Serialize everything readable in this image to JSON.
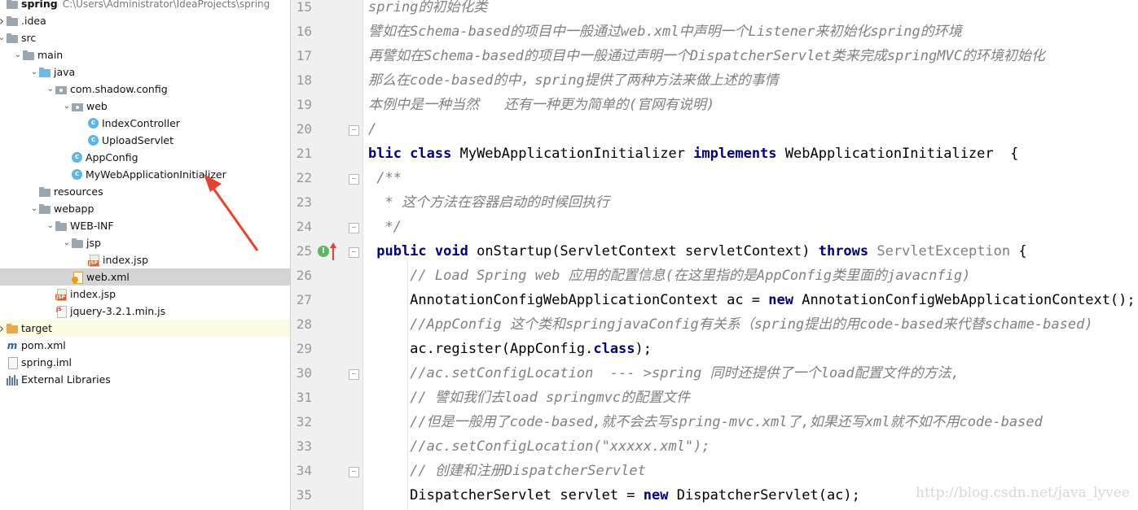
{
  "tree": {
    "items": [
      {
        "label": "spring",
        "path": "C:\\Users\\Administrator\\IdeaProjects\\spring",
        "icon": "folder-icon",
        "arrow": "",
        "indent": 0
      },
      {
        "label": ".idea",
        "icon": "folder-icon",
        "arrow": "collapsed",
        "indent": 0
      },
      {
        "label": "src",
        "icon": "folder-icon",
        "arrow": "expanded",
        "indent": 0
      },
      {
        "label": "main",
        "icon": "folder-icon",
        "arrow": "expanded",
        "indent": 1
      },
      {
        "label": "java",
        "icon": "source-folder-icon",
        "arrow": "expanded",
        "indent": 2
      },
      {
        "label": "com.shadow.config",
        "icon": "package-icon",
        "arrow": "expanded",
        "indent": 3
      },
      {
        "label": "web",
        "icon": "package-icon",
        "arrow": "expanded",
        "indent": 4
      },
      {
        "label": "IndexController",
        "icon": "class-icon",
        "arrow": "",
        "indent": 5
      },
      {
        "label": "UploadServlet",
        "icon": "class-icon",
        "arrow": "",
        "indent": 5
      },
      {
        "label": "AppConfig",
        "icon": "class-icon",
        "arrow": "",
        "indent": 4
      },
      {
        "label": "MyWebApplicationInitializer",
        "icon": "class-icon",
        "arrow": "",
        "indent": 4
      },
      {
        "label": "resources",
        "icon": "resources-folder-icon",
        "arrow": "",
        "indent": 2
      },
      {
        "label": "webapp",
        "icon": "folder-icon",
        "arrow": "expanded",
        "indent": 2
      },
      {
        "label": "WEB-INF",
        "icon": "folder-icon",
        "arrow": "expanded",
        "indent": 3
      },
      {
        "label": "jsp",
        "icon": "folder-icon",
        "arrow": "expanded",
        "indent": 4
      },
      {
        "label": "index.jsp",
        "icon": "jsp-file-icon",
        "arrow": "",
        "indent": 5
      },
      {
        "label": "web.xml",
        "icon": "xml-file-icon",
        "arrow": "",
        "indent": 4
      },
      {
        "label": "index.jsp",
        "icon": "jsp-file-icon",
        "arrow": "",
        "indent": 3
      },
      {
        "label": "jquery-3.2.1.min.js",
        "icon": "js-file-icon",
        "arrow": "",
        "indent": 3
      },
      {
        "label": "target",
        "icon": "excluded-folder-icon",
        "arrow": "collapsed",
        "indent": 0
      },
      {
        "label": "pom.xml",
        "icon": "maven-icon",
        "arrow": "",
        "indent": 0
      },
      {
        "label": "spring.iml",
        "icon": "iml-file-icon",
        "arrow": "",
        "indent": 0
      },
      {
        "label": "External Libraries",
        "icon": "libraries-icon",
        "arrow": "",
        "indent": -1
      }
    ],
    "selected": "web.xml",
    "highlighted": "target"
  },
  "editor": {
    "lines": [
      {
        "n": "15",
        "segments": [
          [
            "cm",
            "spring的初始化类"
          ]
        ]
      },
      {
        "n": "16",
        "segments": [
          [
            "cm",
            "譬如在Schema-based的项目中一般通过web.xml中声明一个Listener来初始化spring的环境"
          ]
        ]
      },
      {
        "n": "17",
        "segments": [
          [
            "cm",
            "再譬如在Schema-based的项目中一般通过声明一个DispatcherServlet类来完成springMVC的环境初始化"
          ]
        ]
      },
      {
        "n": "18",
        "segments": [
          [
            "cm",
            "那么在code-based的中，spring提供了两种方法来做上述的事情"
          ]
        ]
      },
      {
        "n": "19",
        "segments": [
          [
            "cm",
            "本例中是一种当然   还有一种更为简单的(官网有说明)"
          ]
        ]
      },
      {
        "n": "20",
        "segments": [
          [
            "cm",
            "/"
          ]
        ]
      },
      {
        "n": "21",
        "segments": [
          [
            "kw",
            "blic class "
          ],
          [
            "pl",
            "MyWebApplicationInitializer "
          ],
          [
            "kw",
            "implements "
          ],
          [
            "pl",
            "WebApplicationInitializer  {"
          ]
        ]
      },
      {
        "n": "22",
        "segments": [
          [
            "cm",
            " /**"
          ]
        ]
      },
      {
        "n": "23",
        "segments": [
          [
            "cm",
            "  * 这个方法在容器启动的时候回执行"
          ]
        ]
      },
      {
        "n": "24",
        "segments": [
          [
            "cm",
            "  */"
          ]
        ]
      },
      {
        "n": "25",
        "segments": [
          [
            "pl",
            " "
          ],
          [
            "kw",
            "public void "
          ],
          [
            "pl",
            "onStartup(ServletContext servletContext) "
          ],
          [
            "kw",
            "throws "
          ],
          [
            "dim",
            "ServletException "
          ],
          [
            "pl",
            "{"
          ]
        ]
      },
      {
        "n": "26",
        "segments": [
          [
            "cm",
            "     // Load Spring web 应用的配置信息(在这里指的是AppConfig类里面的javacnfig)"
          ]
        ]
      },
      {
        "n": "27",
        "segments": [
          [
            "pl",
            "     AnnotationConfigWebApplicationContext ac = "
          ],
          [
            "kw",
            "new "
          ],
          [
            "pl",
            "AnnotationConfigWebApplicationContext();"
          ]
        ]
      },
      {
        "n": "28",
        "segments": [
          [
            "cm",
            "     //AppConfig 这个类和springjavaConfig有关系（spring提出的用code-based来代替schame-based)"
          ]
        ]
      },
      {
        "n": "29",
        "segments": [
          [
            "pl",
            "     ac.register(AppConfig."
          ],
          [
            "kw",
            "class"
          ],
          [
            "pl",
            ");"
          ]
        ]
      },
      {
        "n": "30",
        "segments": [
          [
            "cm",
            "     //ac.setConfigLocation  --- >spring 同时还提供了一个load配置文件的方法,"
          ]
        ]
      },
      {
        "n": "31",
        "segments": [
          [
            "cm",
            "     // 譬如我们去load springmvc的配置文件"
          ]
        ]
      },
      {
        "n": "32",
        "segments": [
          [
            "cm",
            "     //但是一般用了code-based,就不会去写spring-mvc.xml了,如果还写xml就不如不用code-based"
          ]
        ]
      },
      {
        "n": "33",
        "segments": [
          [
            "cm",
            "     //ac.setConfigLocation(\"xxxxx.xml\");"
          ]
        ]
      },
      {
        "n": "34",
        "segments": [
          [
            "cm",
            "     // 创建和注册DispatcherServlet"
          ]
        ]
      },
      {
        "n": "35",
        "segments": [
          [
            "pl",
            "     DispatcherServlet servlet = "
          ],
          [
            "kw",
            "new "
          ],
          [
            "pl",
            "DispatcherServlet(ac);"
          ]
        ]
      }
    ],
    "gutter_marker": "I",
    "watermark": "http://blog.csdn.net/java_lyvee"
  },
  "colors": {
    "keyword": "#000080",
    "comment": "#808080",
    "selection": "#d4d4d4",
    "annotation_arrow": "#e8412f"
  }
}
